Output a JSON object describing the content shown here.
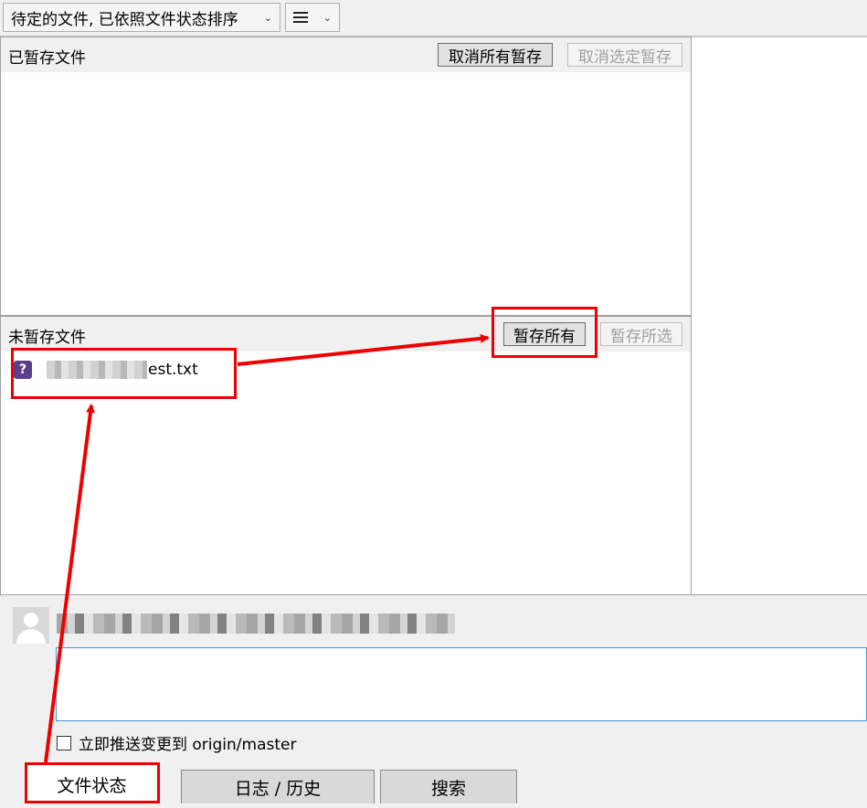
{
  "toolbar": {
    "sort_dropdown": "待定的文件, 已依照文件状态排序",
    "view_icon": "list-icon"
  },
  "staged": {
    "title": "已暂存文件",
    "unstage_all": "取消所有暂存",
    "unstage_selected": "取消选定暂存"
  },
  "unstaged": {
    "title": "未暂存文件",
    "stage_all": "暂存所有",
    "stage_selected": "暂存所选",
    "files": [
      {
        "name": "est.txt",
        "status_icon": "?"
      }
    ]
  },
  "commit": {
    "push_label": "立即推送变更到 origin/master"
  },
  "tabs": [
    {
      "label": "文件状态"
    },
    {
      "label": "日志 / 历史"
    },
    {
      "label": "搜索"
    }
  ],
  "annotation_color": "#ee0000"
}
